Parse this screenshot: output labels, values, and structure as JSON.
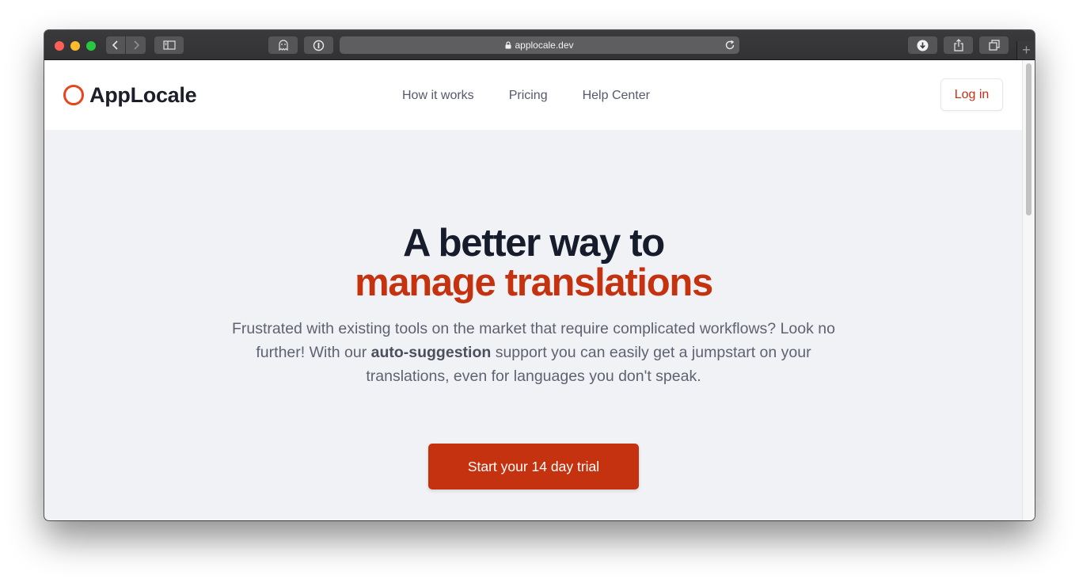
{
  "browser": {
    "url": "applocale.dev",
    "new_tab_glyph": "+",
    "icons": {
      "back": "chevron-left-icon",
      "forward": "chevron-right-icon",
      "sidebar": "sidebar-icon",
      "ghostery": "ghost-icon",
      "password": "password-icon",
      "reload": "reload-icon",
      "download": "download-icon",
      "share": "share-icon",
      "tabs": "tabs-overview-icon"
    }
  },
  "site": {
    "brand": "AppLocale",
    "nav": [
      "How it works",
      "Pricing",
      "Help Center"
    ],
    "login": "Log in",
    "hero": {
      "headline_line1": "A better way to",
      "headline_line2": "manage translations",
      "sub_part1": "Frustrated with existing tools on the market that require complicated workflows? Look no further! With our ",
      "sub_bold": "auto-suggestion",
      "sub_part2": " support you can easily get a jumpstart on your translations, even for languages you don't speak.",
      "cta": "Start your 14 day trial"
    },
    "colors": {
      "accent": "#c5320f",
      "logo_ring": "#e8451f",
      "headline": "#161c2b",
      "hero_bg": "#f1f2f5"
    }
  }
}
